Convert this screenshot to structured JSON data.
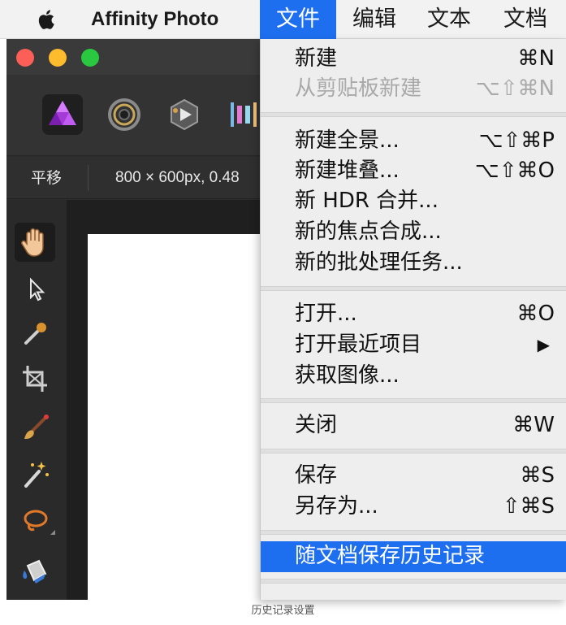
{
  "menubar": {
    "app_name": "Affinity Photo",
    "menus": [
      "文件",
      "编辑",
      "文本",
      "文档"
    ],
    "active_index": 0
  },
  "app": {
    "context_toolbar": {
      "tool_label": "平移",
      "document_info": "800 × 600px, 0.48"
    }
  },
  "file_menu": {
    "new": {
      "label": "新建",
      "shortcut": "⌘N"
    },
    "new_from_clipboard": {
      "label": "从剪贴板新建",
      "shortcut": "⌥⇧⌘N"
    },
    "new_panorama": {
      "label": "新建全景...",
      "shortcut": "⌥⇧⌘P"
    },
    "new_stack": {
      "label": "新建堆叠...",
      "shortcut": "⌥⇧⌘O"
    },
    "new_hdr_merge": {
      "label": "新 HDR 合并..."
    },
    "new_focus_merge": {
      "label": "新的焦点合成..."
    },
    "new_batch_job": {
      "label": "新的批处理任务..."
    },
    "open": {
      "label": "打开...",
      "shortcut": "⌘O"
    },
    "open_recent": {
      "label": "打开最近项目",
      "shortcut": "▶"
    },
    "acquire_image": {
      "label": "获取图像..."
    },
    "close": {
      "label": "关闭",
      "shortcut": "⌘W"
    },
    "save": {
      "label": "保存",
      "shortcut": "⌘S"
    },
    "save_as": {
      "label": "另存为...",
      "shortcut": "⇧⌘S"
    },
    "save_history": {
      "label": "随文档保存历史记录"
    }
  },
  "caption": "历史记录设置",
  "colors": {
    "highlight": "#1e6ff0",
    "menu_bg": "#eeeeee",
    "window_bg": "#2c2c2c"
  }
}
